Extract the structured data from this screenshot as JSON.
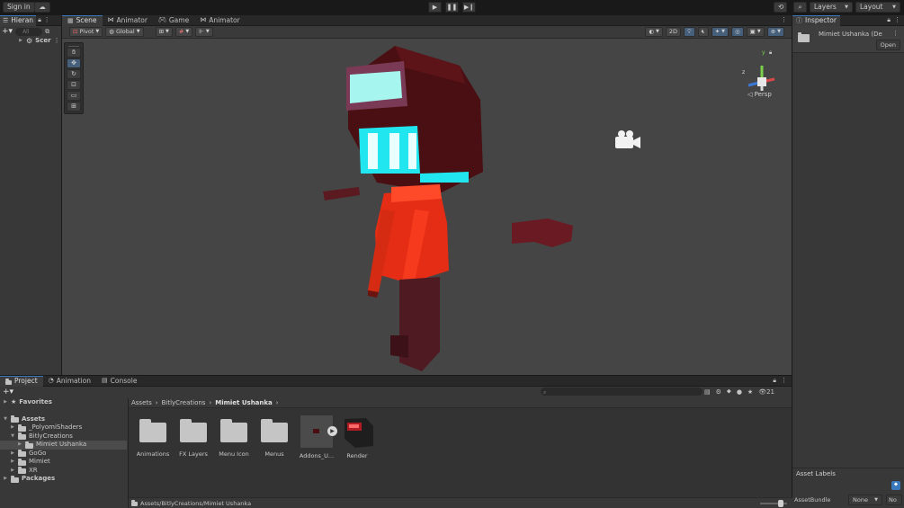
{
  "toolbar": {
    "sign_in": "Sign in",
    "layers": "Layers",
    "layout": "Layout"
  },
  "hierarchy": {
    "tab": "Hieran",
    "search_placeholder": "All",
    "scene_item": "Scer"
  },
  "scene_tabs": [
    {
      "label": "Scene",
      "icon": "grid-icon"
    },
    {
      "label": "Animator",
      "icon": "animator-icon"
    },
    {
      "label": "Game",
      "icon": "gamepad-icon"
    },
    {
      "label": "Animator",
      "icon": "animator-icon"
    }
  ],
  "scene_toolbar": {
    "pivot": "Pivot",
    "global": "Global",
    "mode_2d": "2D"
  },
  "gizmo": {
    "persp": "Persp",
    "axis_y": "y",
    "axis_z": "z"
  },
  "inspector": {
    "tab": "Inspector",
    "object_name": "Mimiet Ushanka (De",
    "open_button": "Open",
    "asset_labels": "Asset Labels",
    "asset_bundle_label": "AssetBundle",
    "asset_bundle_value": "None",
    "variant_value": "No"
  },
  "bottom_tabs": [
    {
      "label": "Project",
      "icon": "folder-icon"
    },
    {
      "label": "Animation",
      "icon": "animation-icon"
    },
    {
      "label": "Console",
      "icon": "console-icon"
    }
  ],
  "project_tree": {
    "favorites": "Favorites",
    "assets": "Assets",
    "items": [
      {
        "label": "_PolyomiShaders",
        "indent": 1,
        "expanded": false
      },
      {
        "label": "BitlyCreations",
        "indent": 1,
        "expanded": true
      },
      {
        "label": "Mimiet Ushanka",
        "indent": 2,
        "expanded": false,
        "selected": true
      },
      {
        "label": "GoGo",
        "indent": 1,
        "expanded": false
      },
      {
        "label": "Mimiet",
        "indent": 1,
        "expanded": false
      },
      {
        "label": "XR",
        "indent": 1,
        "expanded": false
      }
    ],
    "packages": "Packages"
  },
  "breadcrumb": [
    "Assets",
    "BitlyCreations",
    "Mimiet Ushanka"
  ],
  "hidden_count": "21",
  "assets": [
    {
      "label": "Animations",
      "type": "folder"
    },
    {
      "label": "FX Layers",
      "type": "folder"
    },
    {
      "label": "Menu Icon",
      "type": "folder"
    },
    {
      "label": "Menus",
      "type": "folder"
    },
    {
      "label": "Addons_U...",
      "type": "prefab"
    },
    {
      "label": "Render",
      "type": "model"
    }
  ],
  "status_path": "Assets/BitlyCreations/Mimiet Ushanka",
  "colors": {
    "accent": "#3a79bb",
    "scene_bg": "#454545",
    "shirt": "#e52c14",
    "hood": "#4a0f12",
    "face": "#21e6ef"
  }
}
